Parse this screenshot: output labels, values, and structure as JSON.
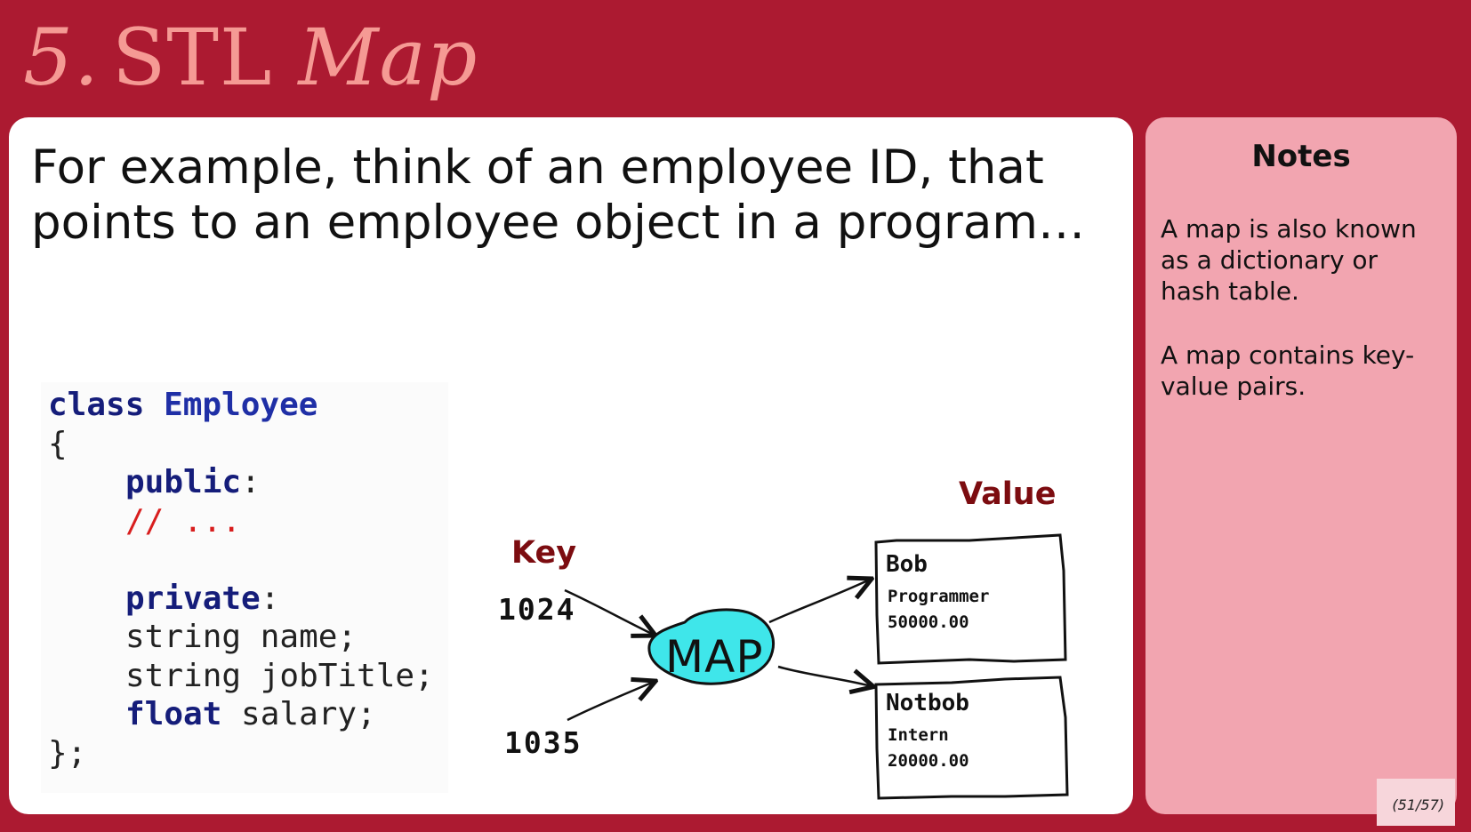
{
  "slide": {
    "title_num": "5.",
    "title_stl": "STL",
    "title_map": "Map",
    "page_counter": "(51/57)"
  },
  "main": {
    "text": "For example, think of an employee ID, that points to an employee object in a program…"
  },
  "code": {
    "line1_kw": "class",
    "line1_name": "Employee",
    "line2": "{",
    "line3_kw": "public",
    "line3_colon": ":",
    "line4": "// ...",
    "line6_kw": "private",
    "line6_colon": ":",
    "line7": "string name;",
    "line8": "string jobTitle;",
    "line9_kw": "float",
    "line9_rest": " salary;",
    "line10": "};"
  },
  "diagram": {
    "key_label": "Key",
    "value_label": "Value",
    "keys": [
      "1024",
      "1035"
    ],
    "map_label": "MAP",
    "values": [
      {
        "name": "Bob",
        "title": "Programmer",
        "salary": "50000.00"
      },
      {
        "name": "Notbob",
        "title": "Intern",
        "salary": "20000.00"
      }
    ],
    "map_fill": "#3fe6ea"
  },
  "notes": {
    "title": "Notes",
    "para1": "A map is also known as a dictionary or hash table.",
    "para2": "A map contains key-value pairs."
  },
  "colors": {
    "background": "#ac1a31",
    "title_color": "#f59a94",
    "notes_bg": "#f2a5b0",
    "label_color": "#7c0c10"
  }
}
